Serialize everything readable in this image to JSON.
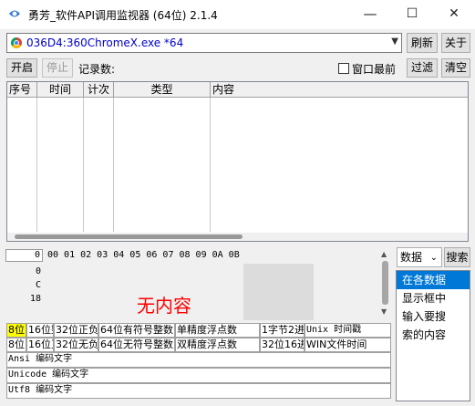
{
  "window": {
    "title": "勇芳_软件API调用监视器 (64位) 2.1.4",
    "minimize": "—",
    "maximize": "☐",
    "close": "✕"
  },
  "process": {
    "selected": "036D4:360ChromeX.exe *64"
  },
  "toolbar": {
    "refresh": "刷新",
    "about": "关于",
    "start": "开启",
    "stop": "停止",
    "record_count_label": "记录数:",
    "topmost_label": "窗口最前",
    "filter": "过滤",
    "clear": "清空"
  },
  "columns": [
    "序号",
    "时间",
    "计次",
    "类型",
    "内容"
  ],
  "hex": {
    "offset": "0",
    "header": "00 01 02 03 04 05 06 07 08 09 0A 0B",
    "rows": [
      "0",
      "C",
      "18"
    ],
    "empty_text": "无内容"
  },
  "types": {
    "row1": [
      "8位",
      "16位整",
      "32位正负",
      "64位有符号整数",
      "单精度浮点数",
      "1字节2进",
      "Unix 时间戳"
    ],
    "row2": [
      "8位",
      "16位正",
      "32位无负",
      "64位无符号整数",
      "双精度浮点数",
      "32位16进",
      "WIN文件时间"
    ],
    "encodings": [
      "Ansi 编码文字",
      "Unicode 编码文字",
      "Utf8 编码文字"
    ]
  },
  "search": {
    "mode": "数据",
    "button": "搜索",
    "help": [
      "在各数据",
      "显示框中",
      "输入要搜",
      "索的内容"
    ]
  }
}
